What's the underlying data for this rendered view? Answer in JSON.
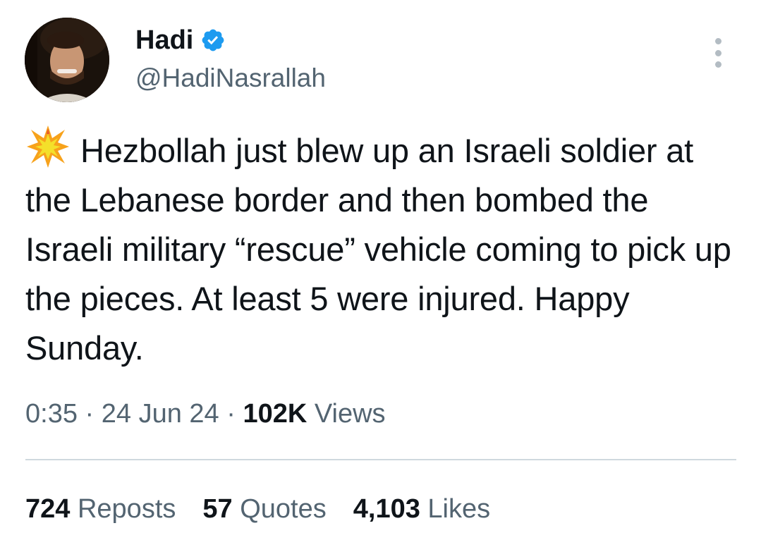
{
  "user": {
    "display_name": "Hadi",
    "handle": "@HadiNasrallah",
    "verified": true
  },
  "tweet": {
    "emoji": "collision-emoji",
    "text": "Hezbollah just blew up an Israeli soldier at the Lebanese border and then bombed the Israeli military “rescue” vehicle coming to pick up the pieces. At least 5 were injured. Happy Sunday."
  },
  "meta": {
    "time": "0:35",
    "separator": " · ",
    "date": "24 Jun 24",
    "views_count": "102K",
    "views_label": "Views"
  },
  "stats": {
    "reposts_count": "724",
    "reposts_label": "Reposts",
    "quotes_count": "57",
    "quotes_label": "Quotes",
    "likes_count": "4,103",
    "likes_label": "Likes"
  },
  "colors": {
    "text": "#0f1419",
    "secondary": "#536471",
    "verified": "#1d9bf0",
    "divider": "#cfd9de"
  }
}
